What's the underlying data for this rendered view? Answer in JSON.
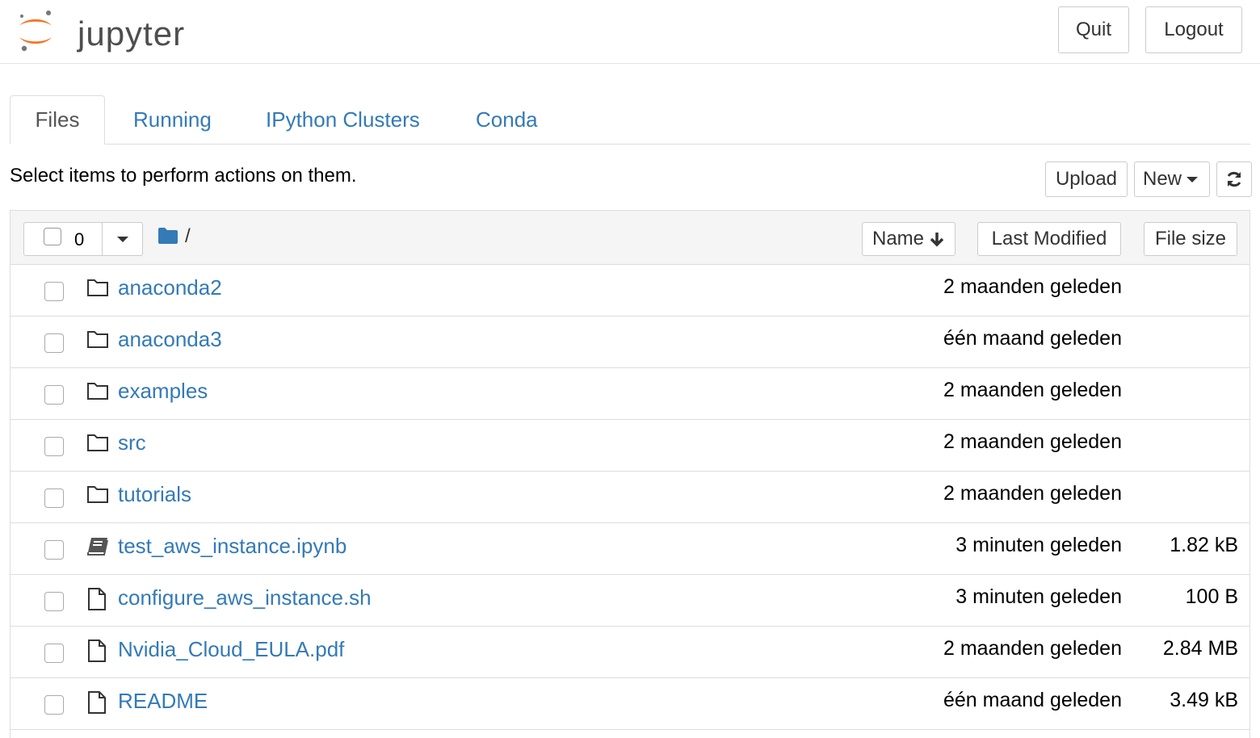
{
  "header": {
    "logo_text": "jupyter",
    "quit_label": "Quit",
    "logout_label": "Logout"
  },
  "tabs": [
    {
      "label": "Files",
      "active": true
    },
    {
      "label": "Running",
      "active": false
    },
    {
      "label": "IPython Clusters",
      "active": false
    },
    {
      "label": "Conda",
      "active": false
    }
  ],
  "toolbar": {
    "hint": "Select items to perform actions on them.",
    "upload_label": "Upload",
    "new_label": "New",
    "refresh_icon": "refresh-icon"
  },
  "list_header": {
    "selected_count": "0",
    "path": "/",
    "sort_name": "Name",
    "sort_modified": "Last Modified",
    "sort_size": "File size"
  },
  "files": [
    {
      "name": "anaconda2",
      "type": "folder",
      "modified": "2 maanden geleden",
      "size": ""
    },
    {
      "name": "anaconda3",
      "type": "folder",
      "modified": "één maand geleden",
      "size": ""
    },
    {
      "name": "examples",
      "type": "folder",
      "modified": "2 maanden geleden",
      "size": ""
    },
    {
      "name": "src",
      "type": "folder",
      "modified": "2 maanden geleden",
      "size": ""
    },
    {
      "name": "tutorials",
      "type": "folder",
      "modified": "2 maanden geleden",
      "size": ""
    },
    {
      "name": "test_aws_instance.ipynb",
      "type": "notebook",
      "modified": "3 minuten geleden",
      "size": "1.82 kB"
    },
    {
      "name": "configure_aws_instance.sh",
      "type": "file",
      "modified": "3 minuten geleden",
      "size": "100 B"
    },
    {
      "name": "Nvidia_Cloud_EULA.pdf",
      "type": "file",
      "modified": "2 maanden geleden",
      "size": "2.84 MB"
    },
    {
      "name": "README",
      "type": "file",
      "modified": "één maand geleden",
      "size": "3.49 kB"
    }
  ],
  "colors": {
    "link": "#337ab7",
    "logo_orange": "#f37626",
    "border": "#dddddd"
  }
}
